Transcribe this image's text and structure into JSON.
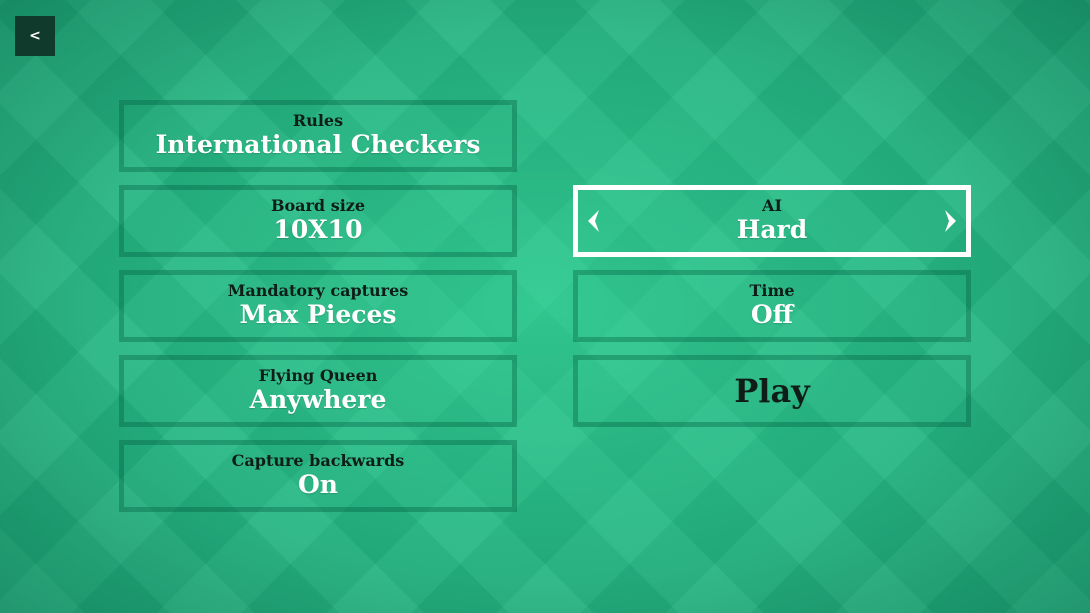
{
  "back_button": {
    "label": "<",
    "icon": "back-arrow-icon"
  },
  "settings": {
    "rules": {
      "label": "Rules",
      "value": "International Checkers"
    },
    "board_size": {
      "label": "Board size",
      "value": "10X10"
    },
    "mandatory_captures": {
      "label": "Mandatory captures",
      "value": "Max Pieces"
    },
    "flying_queen": {
      "label": "Flying Queen",
      "value": "Anywhere"
    },
    "capture_backwards": {
      "label": "Capture backwards",
      "value": "On"
    },
    "ai": {
      "label": "AI",
      "value": "Hard",
      "selected": true
    },
    "time": {
      "label": "Time",
      "value": "Off"
    }
  },
  "play_button": {
    "label": "Play"
  },
  "colors": {
    "background": "#24b482",
    "panel_border": "#1f8f66",
    "selected_border": "#ffffff",
    "label_text": "#0f1d18",
    "value_text": "#ffffff",
    "back_button_bg": "#0f3a2c"
  }
}
